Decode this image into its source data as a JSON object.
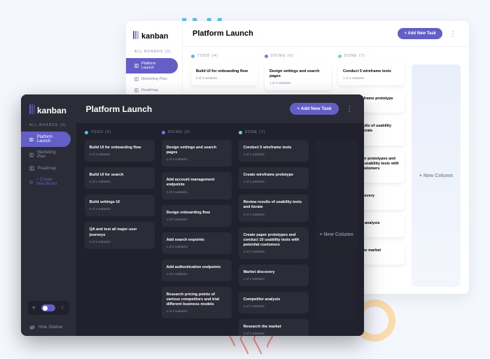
{
  "brand": "kanban",
  "colors": {
    "purple": "#635fc7",
    "todo": "#49c4e5",
    "doing": "#8471f2",
    "done": "#67e2ae"
  },
  "light": {
    "title": "Platform Launch",
    "addTask": "+ Add New Task",
    "allBoards": "ALL BOARDS (3)",
    "nav": [
      {
        "label": "Platform Launch",
        "active": true
      },
      {
        "label": "Marketing Plan"
      },
      {
        "label": "Roadmap"
      }
    ],
    "columns": [
      {
        "name": "TODO (4)",
        "color": "#49c4e5",
        "cards": [
          {
            "t": "Build UI for onboarding flow",
            "s": "0 of 3 subtasks"
          },
          {
            "t": "Build UI for search",
            "s": ""
          }
        ]
      },
      {
        "name": "DOING (6)",
        "color": "#8471f2",
        "cards": [
          {
            "t": "Design settings and search pages",
            "s": "1 of 3 subtasks"
          },
          {
            "t": "Add account management",
            "s": ""
          }
        ]
      },
      {
        "name": "DONE (7)",
        "color": "#67e2ae",
        "cards": [
          {
            "t": "Conduct 5 wireframe tests",
            "s": "1 of 1 subtasks"
          },
          {
            "t": "Create wireframe prototype",
            "s": "1 of 1 subtasks"
          },
          {
            "t": "Review results of usability tests and iterate",
            "s": "3 of 3 subtasks"
          },
          {
            "t": "Create paper prototypes and conduct 10 usability tests with potential customers",
            "s": "2 of 2 subtasks"
          },
          {
            "t": "Market discovery",
            "s": "1 of 1 subtasks"
          },
          {
            "t": "Competitor analysis",
            "s": "2 of 2 subtasks"
          },
          {
            "t": "Research the market",
            "s": "2 of 2 subtasks"
          }
        ]
      }
    ],
    "newColumn": "+ New Column"
  },
  "dark": {
    "title": "Platform Launch",
    "addTask": "+ Add New Task",
    "allBoards": "ALL BOARDS (3)",
    "nav": [
      {
        "label": "Platform Launch",
        "active": true
      },
      {
        "label": "Marketing Plan"
      },
      {
        "label": "Roadmap"
      },
      {
        "label": "+ Create New Board",
        "create": true
      }
    ],
    "hideSidebar": "Hide Sidebar",
    "columns": [
      {
        "name": "TODO (4)",
        "color": "#49c4e5",
        "cards": [
          {
            "t": "Build UI for onboarding flow",
            "s": "0 of 3 subtasks"
          },
          {
            "t": "Build UI for search",
            "s": "0 of 1 subtasks"
          },
          {
            "t": "Build settings UI",
            "s": "0 of 2 subtasks"
          },
          {
            "t": "QA and test all major user journeys",
            "s": "0 of 2 subtasks"
          }
        ]
      },
      {
        "name": "DOING (6)",
        "color": "#8471f2",
        "cards": [
          {
            "t": "Design settings and search pages",
            "s": "1 of 3 subtasks"
          },
          {
            "t": "Add account management endpoints",
            "s": "2 of 3 subtasks"
          },
          {
            "t": "Design onboarding flow",
            "s": "1 of 3 subtasks"
          },
          {
            "t": "Add search enpoints",
            "s": "1 of 2 subtasks"
          },
          {
            "t": "Add authentication endpoints",
            "s": "1 of 2 subtasks"
          },
          {
            "t": "Research pricing points of various competitors and trial different business models",
            "s": "1 of 3 subtasks"
          }
        ]
      },
      {
        "name": "DONE (7)",
        "color": "#67e2ae",
        "cards": [
          {
            "t": "Conduct 5 wireframe tests",
            "s": "1 of 1 subtasks"
          },
          {
            "t": "Create wireframe prototype",
            "s": "1 of 1 subtasks"
          },
          {
            "t": "Review results of usability tests and iterate",
            "s": "3 of 3 subtasks"
          },
          {
            "t": "Create paper prototypes and conduct 10 usability tests with potential customers",
            "s": "2 of 2 subtasks"
          },
          {
            "t": "Market discovery",
            "s": "1 of 1 subtasks"
          },
          {
            "t": "Competitor analysis",
            "s": "2 of 2 subtasks"
          },
          {
            "t": "Research the market",
            "s": "2 of 2 subtasks"
          }
        ]
      }
    ],
    "newColumn": "+ New Column"
  }
}
